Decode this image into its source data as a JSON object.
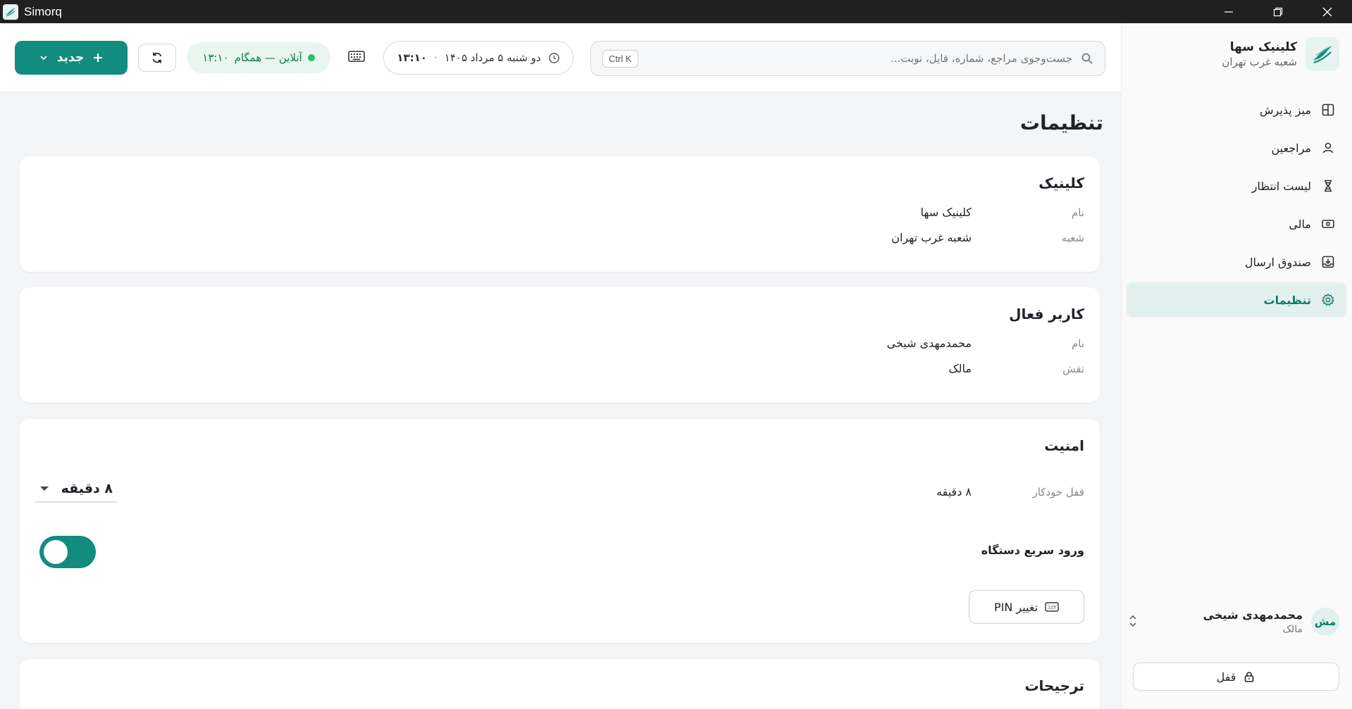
{
  "window": {
    "title": "Simorq"
  },
  "brand": {
    "name": "کلینیک سها",
    "branch": "شعبه غرب تهران"
  },
  "nav": [
    {
      "label": "میز پذیرش",
      "icon": "layout-icon",
      "active": false
    },
    {
      "label": "مراجعین",
      "icon": "user-icon",
      "active": false
    },
    {
      "label": "لیست انتظار",
      "icon": "hourglass-icon",
      "active": false
    },
    {
      "label": "مالی",
      "icon": "money-icon",
      "active": false
    },
    {
      "label": "صندوق ارسال",
      "icon": "outbox-icon",
      "active": false
    },
    {
      "label": "تنظیمات",
      "icon": "gear-icon",
      "active": true
    }
  ],
  "user": {
    "initials": "مش",
    "name": "محمدمهدی شیخی",
    "role": "مالک"
  },
  "lock_label": "قفل",
  "header": {
    "search_placeholder": "جست‌وجوی مراجع، شماره، فایل، نوبت...",
    "search_shortcut": "Ctrl K",
    "date": "دو شنبه ۵ مرداد ۱۴۰۵",
    "separator": "·",
    "time": "۱۳:۱۰",
    "status": "آنلاین — همگام",
    "status_time": "۱۳:۱۰",
    "new_label": "جدید"
  },
  "page": {
    "title": "تنظیمات"
  },
  "clinic_card": {
    "title": "کلینیک",
    "rows": [
      {
        "label": "نام",
        "value": "کلینیک سها"
      },
      {
        "label": "شعبه",
        "value": "شعبه غرب تهران"
      }
    ]
  },
  "user_card": {
    "title": "کاربر فعال",
    "rows": [
      {
        "label": "نام",
        "value": "محمدمهدی شیخی"
      },
      {
        "label": "نقش",
        "value": "مالک"
      }
    ]
  },
  "security_card": {
    "title": "امنیت",
    "auto_lock_label": "قفل خودکار",
    "auto_lock_value": "۸ دقیقه",
    "auto_lock_selected": "۸ دقیقه",
    "quick_login_label": "ورود سریع دستگاه",
    "quick_login_on": true,
    "change_pin_label": "تغییر PIN"
  },
  "prefs_card": {
    "title": "ترجیحات"
  },
  "colors": {
    "accent": "#128c7e",
    "status_green": "#23c16b"
  }
}
